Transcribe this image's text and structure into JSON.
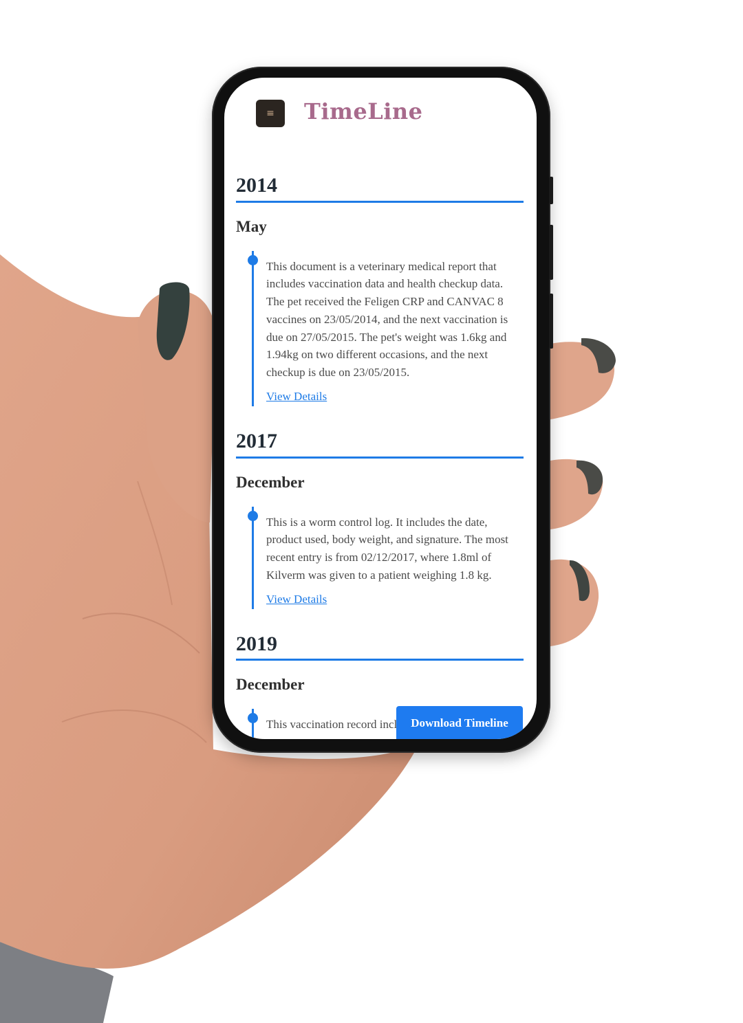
{
  "header": {
    "menu_icon": "menu-icon",
    "menu_glyph": "≡",
    "title": "TimeLine"
  },
  "colors": {
    "accent": "#1e7be6",
    "title": "#a86a8c",
    "menu_bg": "#2b2520"
  },
  "timeline": [
    {
      "year": "2014",
      "month": "May",
      "text": "This document is a veterinary medical report that includes vaccination data and health checkup data. The pet received the Feligen CRP and CANVAC 8 vaccines on 23/05/2014, and the next vaccination is due on 27/05/2015. The pet's weight was 1.6kg and 1.94kg on two different occasions, and the next checkup is due on 23/05/2015.",
      "link": "View Details"
    },
    {
      "year": "2017",
      "month": "December",
      "text": "This is a worm control log. It includes the date, product used, body weight, and signature. The most recent entry is from 02/12/2017, where 1.8ml of Kilverm was given to a patient weighing 1.8 kg.",
      "link": "View Details"
    },
    {
      "year": "2019",
      "month": "December",
      "text": "This vaccination record incl",
      "link": ""
    }
  ],
  "download_label": "Download Timeline"
}
